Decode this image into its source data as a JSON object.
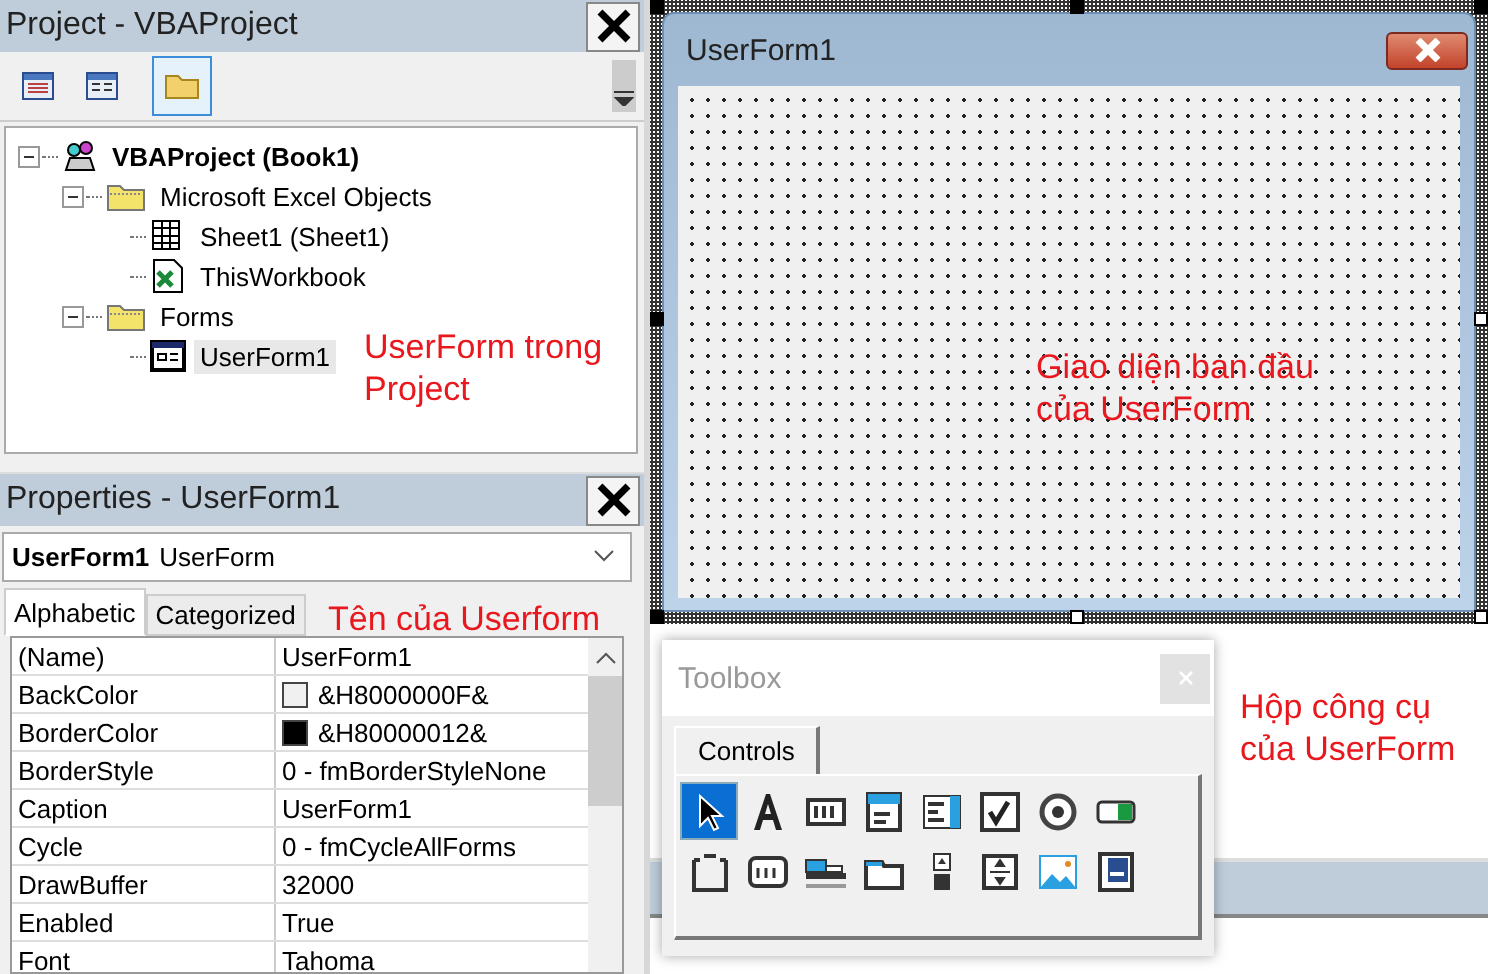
{
  "project_panel": {
    "title": "Project - VBAProject",
    "toolbar": [
      {
        "selected": false
      },
      {
        "selected": false
      },
      {
        "selected": true
      }
    ],
    "tree": [
      {
        "label": "VBAProject (Book1)",
        "kind": "project",
        "expanded": true,
        "selected": false,
        "children": [
          {
            "label": "Microsoft Excel Objects",
            "kind": "folder",
            "expanded": true,
            "selected": false,
            "children": [
              {
                "label": "Sheet1 (Sheet1)",
                "kind": "sheet",
                "selected": false
              },
              {
                "label": "ThisWorkbook",
                "kind": "workbook",
                "selected": false
              }
            ]
          },
          {
            "label": "Forms",
            "kind": "folder",
            "expanded": true,
            "selected": false,
            "children": [
              {
                "label": "UserForm1",
                "kind": "form",
                "selected": true
              }
            ]
          }
        ]
      }
    ]
  },
  "properties_panel": {
    "title": "Properties - UserForm1",
    "object_name": "UserForm1",
    "object_type": "UserForm",
    "tabs": [
      {
        "label": "Alphabetic",
        "selected": true
      },
      {
        "label": "Categorized",
        "selected": false
      }
    ],
    "rows": [
      {
        "name": "(Name)",
        "value": "UserForm1"
      },
      {
        "name": "BackColor",
        "value": "&H8000000F&",
        "color": "#f0f0f0"
      },
      {
        "name": "BorderColor",
        "value": "&H80000012&",
        "color": "#000000"
      },
      {
        "name": "BorderStyle",
        "value": "0 - fmBorderStyleNone"
      },
      {
        "name": "Caption",
        "value": "UserForm1"
      },
      {
        "name": "Cycle",
        "value": "0 - fmCycleAllForms"
      },
      {
        "name": "DrawBuffer",
        "value": "32000"
      },
      {
        "name": "Enabled",
        "value": "True"
      },
      {
        "name": "Font",
        "value": "Tahoma"
      }
    ]
  },
  "userform": {
    "title": "UserForm1"
  },
  "toolbox": {
    "title": "Toolbox",
    "tab": "Controls",
    "tools": [
      {
        "selected": true
      },
      {
        "selected": false
      },
      {
        "selected": false
      },
      {
        "selected": false
      },
      {
        "selected": false
      },
      {
        "selected": false
      },
      {
        "selected": false
      },
      {
        "selected": false
      },
      {
        "selected": false
      },
      {
        "selected": false
      },
      {
        "selected": false
      },
      {
        "selected": false
      },
      {
        "selected": false
      },
      {
        "selected": false
      },
      {
        "selected": false
      },
      {
        "selected": false
      }
    ]
  },
  "annotations": [
    {
      "kind": "project",
      "text": "UserForm trong Project"
    },
    {
      "kind": "form",
      "text": "Giao diện ban đầu của UserForm"
    },
    {
      "kind": "name",
      "text": "Tên của Userform"
    },
    {
      "kind": "toolbox",
      "text": "Hộp công cụ của UserForm"
    }
  ]
}
